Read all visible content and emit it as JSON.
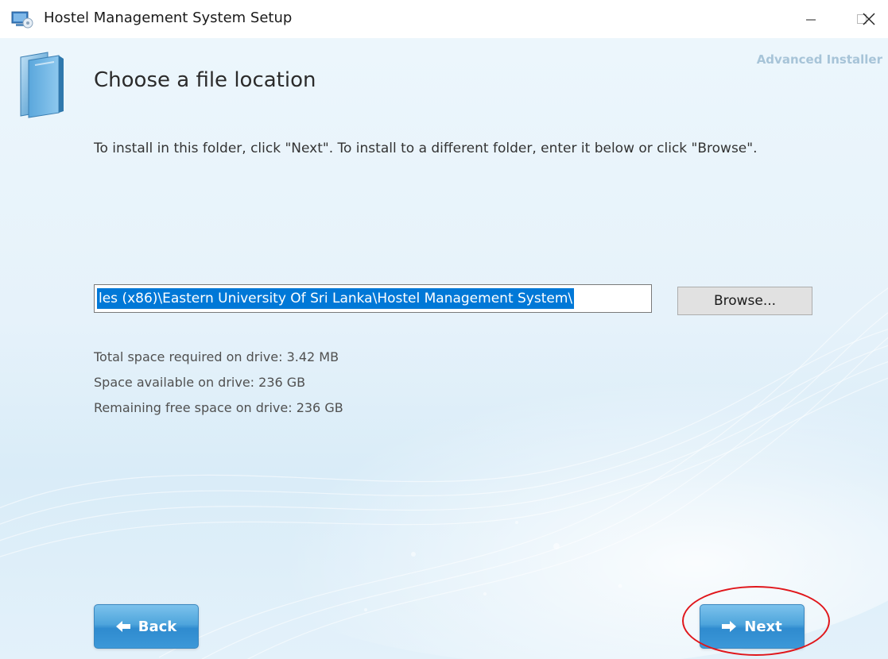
{
  "window": {
    "title": "Hostel Management System Setup",
    "icons": {
      "app": "installer-app-icon",
      "minimize": "minimize-icon",
      "maximize": "maximize-icon",
      "close": "close-icon"
    }
  },
  "header": {
    "brand": "Advanced Installer",
    "heading": "Choose a file location",
    "icon": "folder-icon"
  },
  "main": {
    "instructions": "To install in this folder, click \"Next\". To install to a different folder, enter it below or click \"Browse\".",
    "path_value": "les (x86)\\Eastern University Of Sri Lanka\\Hostel Management System\\",
    "browse_label": "Browse...",
    "space": {
      "required": "Total space required on drive: 3.42 MB",
      "available": "Space available on drive: 236 GB",
      "remaining": "Remaining free space on drive: 236 GB"
    }
  },
  "footer": {
    "back_label": "Back",
    "next_label": "Next"
  },
  "colors": {
    "selection": "#0078d7",
    "button_blue": "#3c98d8",
    "highlight_ring": "#e0161b",
    "brand_text": "#a7c4d8"
  }
}
